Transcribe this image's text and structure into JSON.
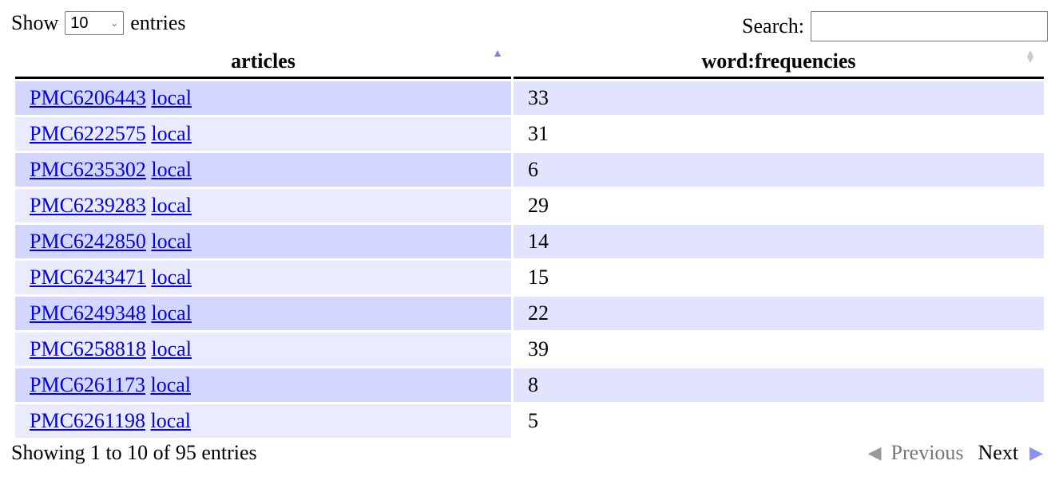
{
  "length": {
    "show": "Show",
    "value": "10",
    "entries": "entries"
  },
  "search": {
    "label": "Search:",
    "value": ""
  },
  "columns": [
    "articles",
    "word:frequencies"
  ],
  "rows": [
    {
      "id": "PMC6206443",
      "local": "local",
      "freq": "33"
    },
    {
      "id": "PMC6222575",
      "local": "local",
      "freq": "31"
    },
    {
      "id": "PMC6235302",
      "local": "local",
      "freq": "6"
    },
    {
      "id": "PMC6239283",
      "local": "local",
      "freq": "29"
    },
    {
      "id": "PMC6242850",
      "local": "local",
      "freq": "14"
    },
    {
      "id": "PMC6243471",
      "local": "local",
      "freq": "15"
    },
    {
      "id": "PMC6249348",
      "local": "local",
      "freq": "22"
    },
    {
      "id": "PMC6258818",
      "local": "local",
      "freq": "39"
    },
    {
      "id": "PMC6261173",
      "local": "local",
      "freq": "8"
    },
    {
      "id": "PMC6261198",
      "local": "local",
      "freq": "5"
    }
  ],
  "info": "Showing 1 to 10 of 95 entries",
  "pagination": {
    "previous": "Previous",
    "next": "Next"
  }
}
